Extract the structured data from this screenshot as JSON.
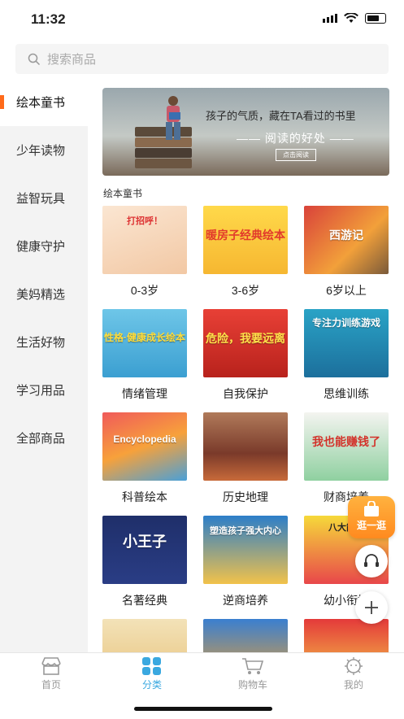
{
  "status": {
    "time": "11:32"
  },
  "search": {
    "placeholder": "搜索商品"
  },
  "sidebar": {
    "items": [
      {
        "label": "绘本童书"
      },
      {
        "label": "少年读物"
      },
      {
        "label": "益智玩具"
      },
      {
        "label": "健康守护"
      },
      {
        "label": "美妈精选"
      },
      {
        "label": "生活好物"
      },
      {
        "label": "学习用品"
      },
      {
        "label": "全部商品"
      }
    ]
  },
  "banner": {
    "line1": "孩子的气质，藏在TA看过的书里",
    "line2": "—— 阅读的好处 ——",
    "button": "点击阅读"
  },
  "section_title": "绘本童书",
  "products": [
    {
      "label": "0-3岁",
      "cover": "打招呼！"
    },
    {
      "label": "3-6岁",
      "cover": "暖房子经典绘本"
    },
    {
      "label": "6岁以上",
      "cover": "西游记"
    },
    {
      "label": "情绪管理",
      "cover": "性格·健康成长绘本"
    },
    {
      "label": "自我保护",
      "cover": "危险，我要远离"
    },
    {
      "label": "思维训练",
      "cover": "专注力训练游戏"
    },
    {
      "label": "科普绘本",
      "cover": "Encyclopedia"
    },
    {
      "label": "历史地理",
      "cover": ""
    },
    {
      "label": "财商培养",
      "cover": "我也能赚钱了"
    },
    {
      "label": "名著经典",
      "cover": "小王子"
    },
    {
      "label": "逆商培养",
      "cover": "塑造孩子强大内心"
    },
    {
      "label": "幼小衔接",
      "cover": "八大能力"
    }
  ],
  "floating": {
    "shop_label": "逛一逛"
  },
  "tabs": [
    {
      "label": "首页"
    },
    {
      "label": "分类"
    },
    {
      "label": "购物车"
    },
    {
      "label": "我的"
    }
  ],
  "colors": {
    "accent": "#ff6a1a",
    "tab_active": "#3aa8e0"
  }
}
